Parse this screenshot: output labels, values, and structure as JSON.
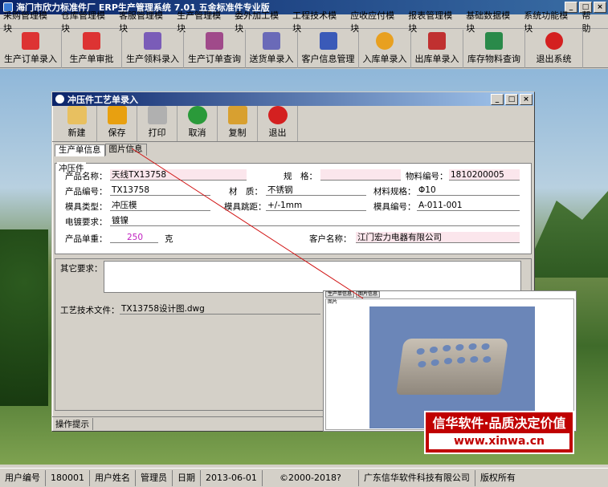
{
  "app": {
    "title": "海门市欣力标准件厂 ERP生产管理系统  7.01 五金标准件专业版"
  },
  "menu": [
    "采购管理模块",
    "仓库管理模块",
    "客服管理模块",
    "生产管理模块",
    "委外加工模块",
    "工程技术模块",
    "应收应付模块",
    "报表管理模块",
    "基础数据模块",
    "系统功能模块",
    "帮助"
  ],
  "toolbar": [
    {
      "label": "生产订单录入",
      "icon": "pdf-icon",
      "color": "#d33"
    },
    {
      "label": "生产单审批",
      "icon": "pdf-icon",
      "color": "#d33"
    },
    {
      "label": "生产领料录入",
      "icon": "feather-icon",
      "color": "#7a5cb8"
    },
    {
      "label": "生产订单查询",
      "icon": "feather-icon",
      "color": "#a04a8a"
    },
    {
      "label": "送货单录入",
      "icon": "feather-icon",
      "color": "#6a6ab8"
    },
    {
      "label": "客户信息管理",
      "icon": "book-icon",
      "color": "#3a5ab8"
    },
    {
      "label": "入库单录入",
      "icon": "flower-icon",
      "color": "#e8a020"
    },
    {
      "label": "出库单录入",
      "icon": "feather-icon",
      "color": "#c03030"
    },
    {
      "label": "库存物料查询",
      "icon": "feather-icon",
      "color": "#2a8a4a"
    },
    {
      "label": "退出系统",
      "icon": "power-icon",
      "color": "#d42020"
    }
  ],
  "child": {
    "title": "冲压件工艺单录入",
    "buttons": [
      {
        "label": "新建",
        "icon": "notepad-icon",
        "color": "#e8c060"
      },
      {
        "label": "保存",
        "icon": "floppy-icon",
        "color": "#e8a010"
      },
      {
        "label": "打印",
        "icon": "printer-icon",
        "color": "#b0b0b0"
      },
      {
        "label": "取消",
        "icon": "refresh-icon",
        "color": "#2a9a3a"
      },
      {
        "label": "复制",
        "icon": "folder-icon",
        "color": "#d8a030"
      },
      {
        "label": "退出",
        "icon": "power-icon",
        "color": "#d42020"
      }
    ],
    "tabs": [
      "生产单信息",
      "图片信息"
    ],
    "group": "冲压件",
    "fields": {
      "name_label": "产品名称：",
      "name": "天线TX13758",
      "spec_label": "规　格：",
      "spec": "",
      "matno_label": "物料编号：",
      "matno": "1810200005",
      "code_label": "产品编号：",
      "code": "TX13758",
      "material_label": "材　质：",
      "material": "不锈钢",
      "matspec_label": "材料规格：",
      "matspec": "Φ10",
      "mold_type_label": "模具类型：",
      "mold_type": "冲压模",
      "mold_dist_label": "模具跳距：",
      "mold_dist": "+/-1mm",
      "mold_no_label": "模具编号：",
      "mold_no": "A-011-001",
      "plating_label": "电镀要求：",
      "plating": "镀镍",
      "weight_label": "产品单重：",
      "weight": "250",
      "weight_unit": "克",
      "customer_label": "客户名称：",
      "customer": "江门宏力电器有限公司",
      "other_label": "其它要求：",
      "techfile_label": "工艺技术文件：",
      "techfile": "TX13758设计图.dwg"
    },
    "status": "操作提示"
  },
  "popup": {
    "tabs": [
      "生产单信息",
      "图片信息"
    ],
    "label": "图片"
  },
  "ad": {
    "line1": "信华软件·品质决定价值",
    "line2": "www.xinwa.cn"
  },
  "statusbar": {
    "user_no_label": "用户编号",
    "user_no": "180001",
    "user_name_label": "用户姓名",
    "user_name": "管理员",
    "date_label": "日期",
    "date": "2013-06-01",
    "copyright": "©2000-2018?",
    "company": "广东信华软件科技有限公司",
    "rights": "版权所有"
  }
}
